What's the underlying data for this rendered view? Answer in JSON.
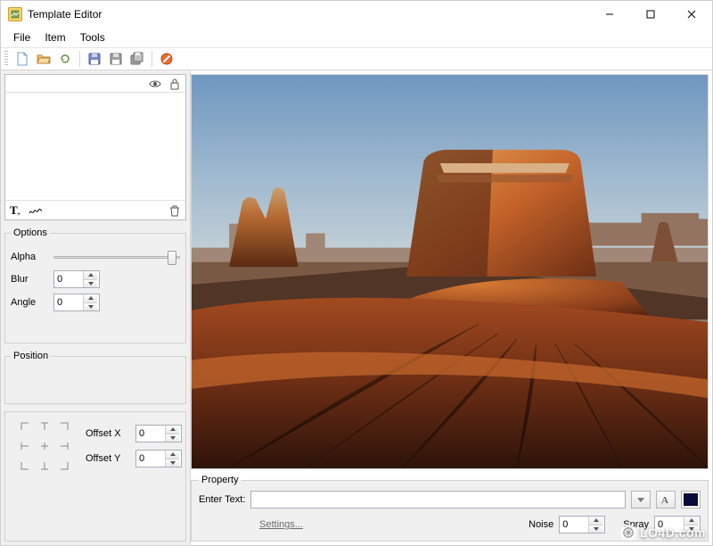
{
  "window": {
    "title": "Template Editor"
  },
  "menu": {
    "file": "File",
    "item": "Item",
    "tools": "Tools"
  },
  "options": {
    "legend": "Options",
    "alpha_label": "Alpha",
    "alpha_value": 94,
    "blur_label": "Blur",
    "blur_value": "0",
    "angle_label": "Angle",
    "angle_value": "0"
  },
  "position": {
    "legend": "Position",
    "offset_x_label": "Offset X",
    "offset_x_value": "0",
    "offset_y_label": "Offset Y",
    "offset_y_value": "0"
  },
  "property": {
    "legend": "Property",
    "enter_text_label": "Enter Text:",
    "text_value": "",
    "settings_label": "Settings...",
    "noise_label": "Noise",
    "noise_value": "0",
    "spray_label": "Spray",
    "spray_value": "0",
    "text_color": "#0a0a3a"
  },
  "watermark": "LO4D.com"
}
